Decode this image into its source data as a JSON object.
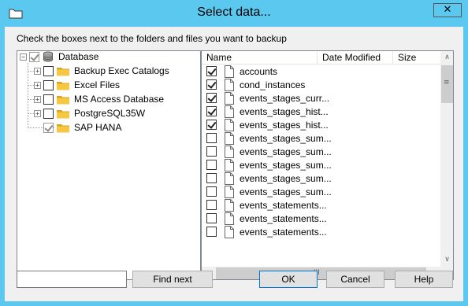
{
  "window": {
    "title": "Select data...",
    "close_glyph": "✕"
  },
  "instructions": "Check the boxes next to the folders and files you want to backup",
  "tree": {
    "root": {
      "label": "Database",
      "expander": "−",
      "checked": true,
      "icon": "database-icon"
    },
    "children": [
      {
        "label": "Backup Exec Catalogs",
        "expander": "+",
        "checked": false,
        "icon": "folder-icon"
      },
      {
        "label": "Excel Files",
        "expander": "+",
        "checked": false,
        "icon": "folder-icon"
      },
      {
        "label": "MS Access Database",
        "expander": "+",
        "checked": false,
        "icon": "folder-icon"
      },
      {
        "label": "PostgreSQL35W",
        "expander": "+",
        "checked": false,
        "icon": "folder-icon"
      },
      {
        "label": "SAP HANA",
        "expander": "",
        "checked": true,
        "icon": "folder-icon"
      }
    ]
  },
  "file_list": {
    "columns": [
      "Name",
      "Date Modified",
      "Size"
    ],
    "rows": [
      {
        "name": "accounts",
        "checked": true
      },
      {
        "name": "cond_instances",
        "checked": true
      },
      {
        "name": "events_stages_curr...",
        "checked": true
      },
      {
        "name": "events_stages_hist...",
        "checked": true
      },
      {
        "name": "events_stages_hist...",
        "checked": true
      },
      {
        "name": "events_stages_sum...",
        "checked": false
      },
      {
        "name": "events_stages_sum...",
        "checked": false
      },
      {
        "name": "events_stages_sum...",
        "checked": false
      },
      {
        "name": "events_stages_sum...",
        "checked": false
      },
      {
        "name": "events_stages_sum...",
        "checked": false
      },
      {
        "name": "events_statements...",
        "checked": false
      },
      {
        "name": "events_statements...",
        "checked": false
      },
      {
        "name": "events_statements...",
        "checked": false
      }
    ]
  },
  "scroll": {
    "up": "∧",
    "down": "∨",
    "left": "<",
    "right": ">",
    "vgrip": "≡",
    "hgrip": "III"
  },
  "footer": {
    "search_value": "",
    "find_next": "Find next",
    "ok": "OK",
    "cancel": "Cancel",
    "help": "Help"
  },
  "colors": {
    "titlebar": "#5bc9ef",
    "folder": "#f4c842"
  }
}
